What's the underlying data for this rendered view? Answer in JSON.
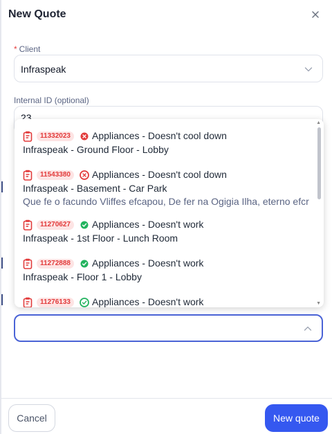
{
  "modal": {
    "title": "New Quote"
  },
  "client": {
    "label": "Client",
    "required_mark": "*",
    "value": "Infraspeak"
  },
  "internal_id": {
    "label": "Internal ID (optional)",
    "value": "23"
  },
  "dropdown": {
    "items": [
      {
        "code": "11332023",
        "status": "error",
        "issue": "Appliances - Doesn't cool down",
        "location": "Infraspeak - Ground Floor - Lobby",
        "description": ""
      },
      {
        "code": "11543380",
        "status": "error-outline",
        "issue": "Appliances - Doesn't cool down",
        "location": "Infraspeak - Basement - Car Park",
        "description": "Que fe o facundo Vliffes efcapou, De fer na Ogigia Ilha, eterno efcr"
      },
      {
        "code": "11270627",
        "status": "ok",
        "issue": "Appliances - Doesn't work",
        "location": "Infraspeak - 1st Floor - Lunch Room",
        "description": ""
      },
      {
        "code": "11272888",
        "status": "ok",
        "issue": "Appliances - Doesn't work",
        "location": "Infraspeak - Floor 1 - Lobby",
        "description": ""
      },
      {
        "code": "11276133",
        "status": "ok-outline",
        "issue": "Appliances - Doesn't work",
        "location": "",
        "description": ""
      }
    ]
  },
  "colors": {
    "accent": "#3558f0",
    "badge_bg": "#fde4e4",
    "badge_text": "#e23b3b",
    "error": "#e23b3b",
    "ok": "#22b35e"
  },
  "footer": {
    "cancel_label": "Cancel",
    "submit_label": "New quote"
  }
}
